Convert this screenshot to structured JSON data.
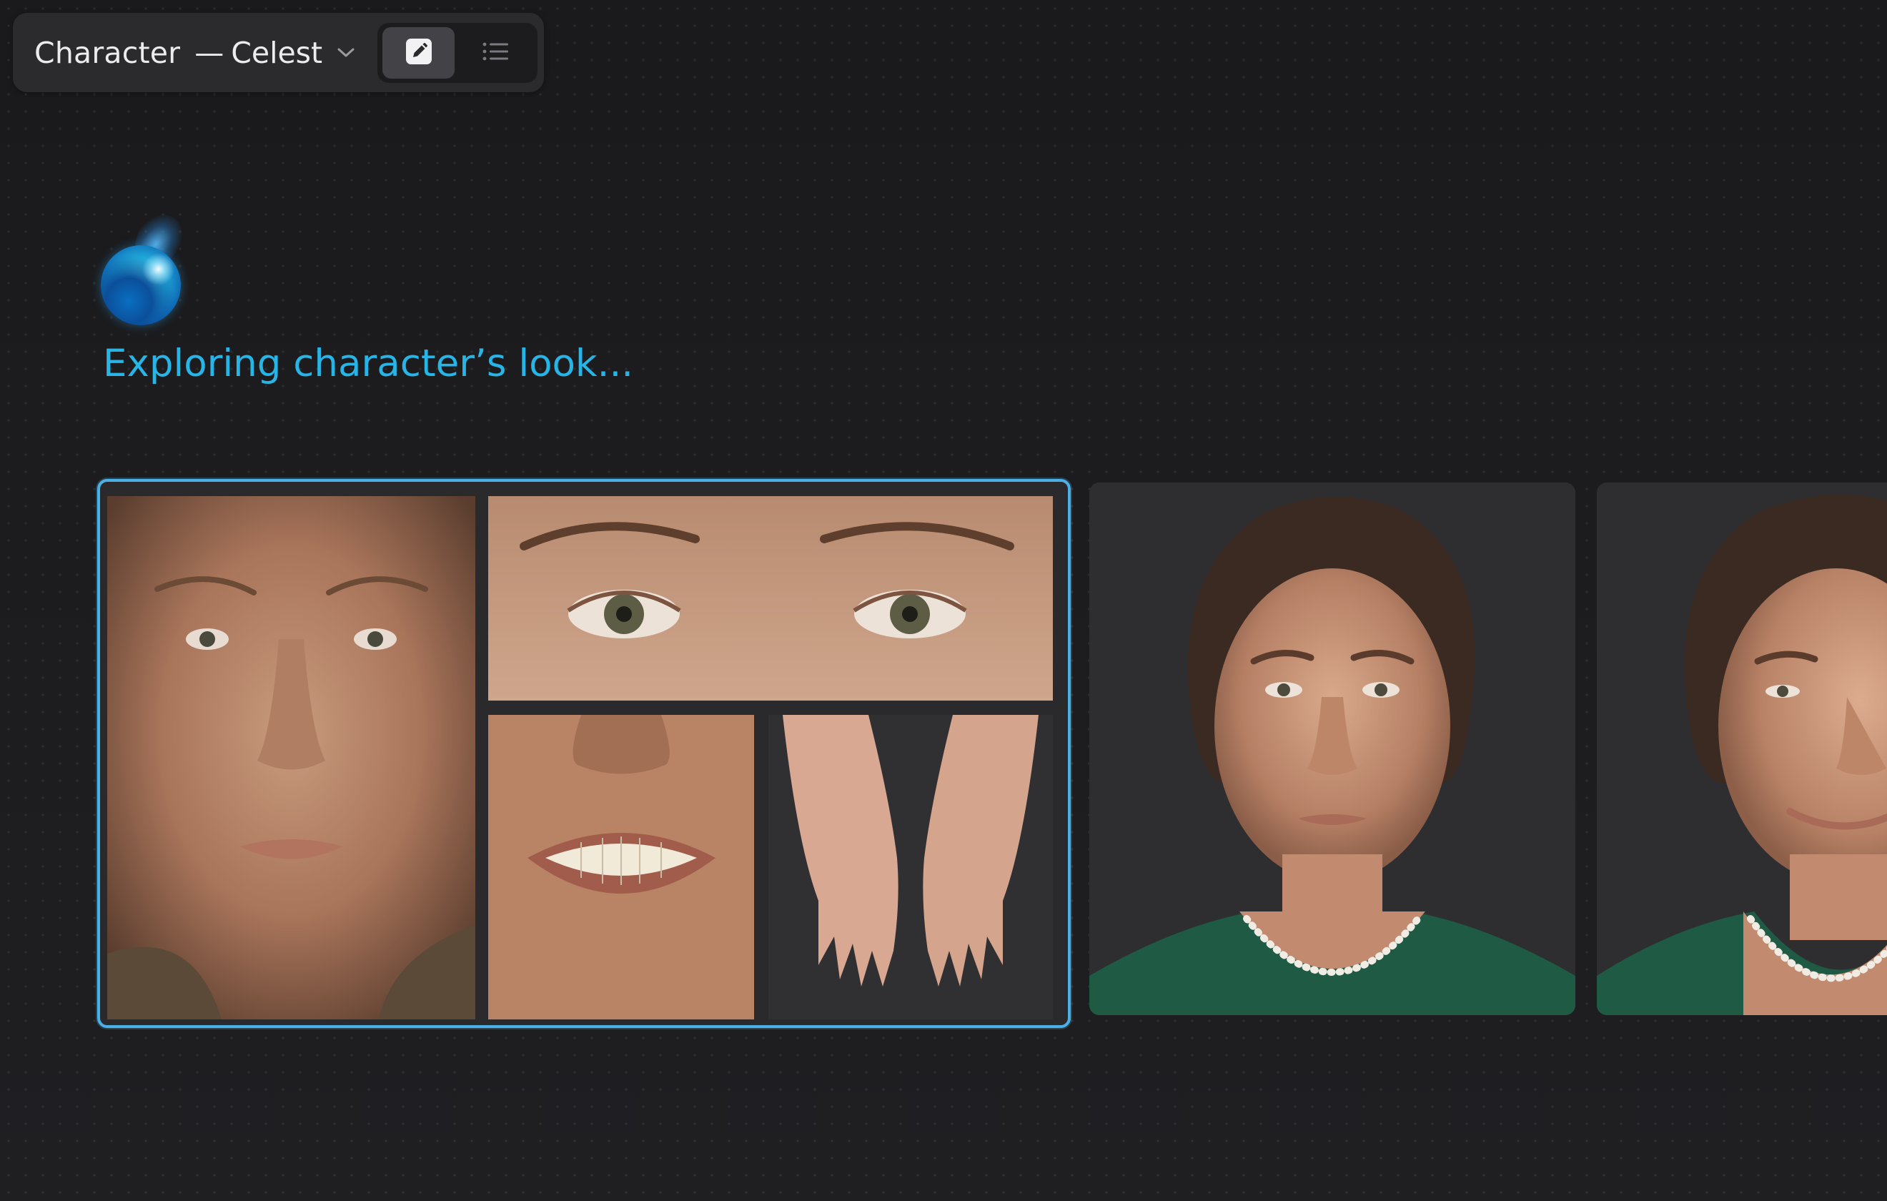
{
  "header": {
    "title": "Character",
    "separator": "—",
    "character_name": "Celest",
    "dropdown_icon": "chevron-down-icon",
    "view_toggle": {
      "edit_icon": "pencil-square-icon",
      "list_icon": "list-icon",
      "active": "edit"
    }
  },
  "status": {
    "orb_icon": "ai-orb-icon",
    "message": "Exploring character’s look..."
  },
  "cards": [
    {
      "id": "reference-sheet",
      "selected": true,
      "panels": [
        "face-front",
        "eyes-closeup",
        "mouth-closeup",
        "hands"
      ]
    },
    {
      "id": "portrait-neutral",
      "selected": false
    },
    {
      "id": "portrait-smile",
      "selected": false
    }
  ],
  "colors": {
    "accent": "#27b4e6",
    "selection_border": "#4ab0e6",
    "toolbar_bg": "#2b2b2e",
    "canvas_bg": "#1b1b1d"
  }
}
